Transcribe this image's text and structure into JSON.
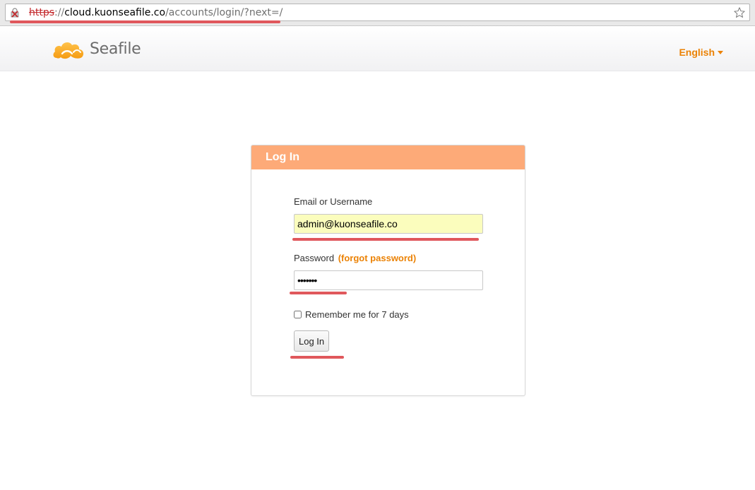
{
  "browser": {
    "url_scheme": "https",
    "url_sep": "://",
    "url_host": "cloud.kuonseafile.co",
    "url_path": "/accounts/login/?next=/",
    "lock_icon": "broken-ssl-lock-icon",
    "star_icon": "bookmark-star-icon"
  },
  "header": {
    "logo_text": "Seafile",
    "language": "English"
  },
  "login": {
    "title": "Log In",
    "email_label": "Email or Username",
    "email_value": "admin@kuonseafile.co",
    "password_label": "Password",
    "forgot_link": "(forgot password)",
    "password_value": "•••••••",
    "remember_label": "Remember me for 7 days",
    "submit_label": "Log In"
  },
  "colors": {
    "accent": "#eb8205",
    "panel_header": "#fdaa78",
    "autofill": "#fbfdbd",
    "annotation_mark": "#e0585c"
  }
}
